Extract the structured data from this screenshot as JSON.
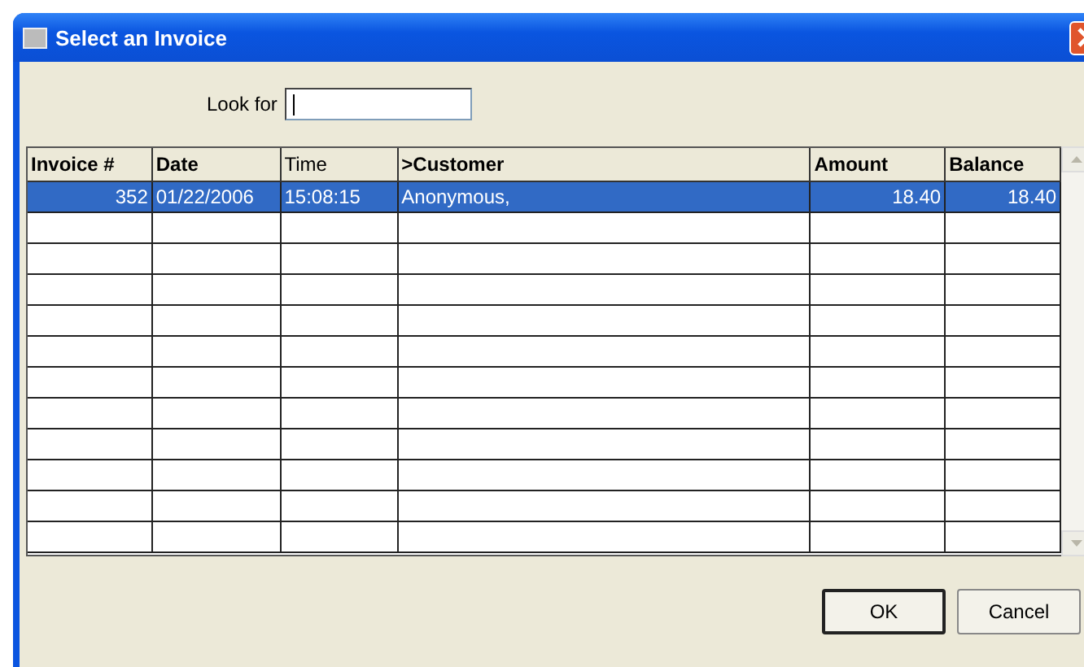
{
  "window": {
    "title": "Select an Invoice"
  },
  "search": {
    "label": "Look for"
  },
  "table": {
    "columns": [
      {
        "label": "Invoice #",
        "bold": true,
        "kind": "number"
      },
      {
        "label": "Date",
        "bold": true,
        "kind": "text"
      },
      {
        "label": "Time",
        "bold": false,
        "kind": "text"
      },
      {
        "label": ">Customer",
        "bold": true,
        "kind": "text"
      },
      {
        "label": "Amount",
        "bold": true,
        "kind": "number"
      },
      {
        "label": "Balance",
        "bold": true,
        "kind": "number"
      }
    ],
    "rows": [
      {
        "cells": [
          "352",
          "01/22/2006",
          "15:08:15",
          "Anonymous,",
          "18.40",
          "18.40"
        ],
        "selected": true
      }
    ]
  },
  "buttons": [
    {
      "label": "OK",
      "default": true
    },
    {
      "label": "Cancel",
      "default": false
    }
  ]
}
